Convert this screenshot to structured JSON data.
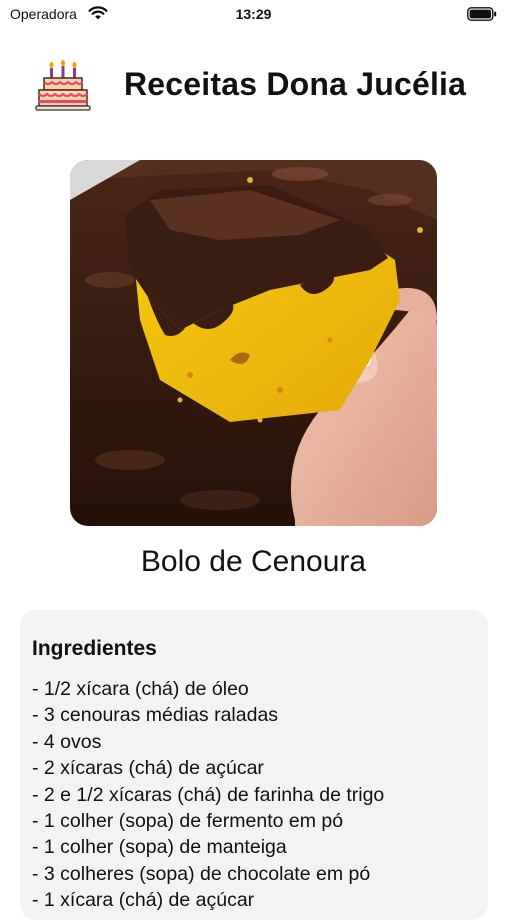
{
  "status_bar": {
    "carrier": "Operadora",
    "time": "13:29",
    "icons": [
      "wifi-icon",
      "battery-icon"
    ]
  },
  "header": {
    "icon": "birthday-cake-icon",
    "title": "Receitas Dona Jucélia"
  },
  "recipe": {
    "image": "cake-photo",
    "name": "Bolo de Cenoura"
  },
  "ingredients": {
    "title": "Ingredientes",
    "items": [
      "- 1/2 xícara (chá) de óleo",
      "- 3 cenouras médias raladas",
      "- 4 ovos",
      "- 2 xícaras (chá) de açúcar",
      "- 2 e 1/2 xícaras (chá) de farinha de trigo",
      "- 1 colher (sopa) de fermento em pó",
      "- 1 colher (sopa) de manteiga",
      "- 3 colheres (sopa) de chocolate em pó",
      "- 1 xícara (chá) de açúcar"
    ]
  },
  "colors": {
    "background": "#ffffff",
    "card": "#f3f3f5",
    "cake_yellow": "#f2c200",
    "chocolate": "#3a1d12"
  }
}
